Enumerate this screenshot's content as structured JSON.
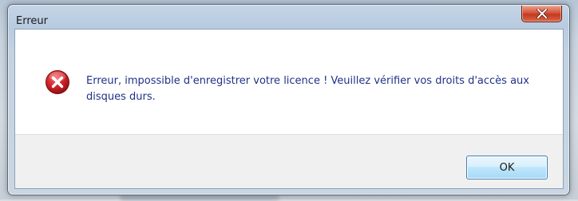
{
  "dialog": {
    "title": "Erreur",
    "message": "Erreur, impossible d'enregistrer votre licence ! Veuillez vérifier vos droits d'accès aux disques durs.",
    "icon": "error-icon",
    "ok_label": "OK",
    "close_icon": "close-icon"
  },
  "colors": {
    "message_text": "#1e3287",
    "close_button": "#c23a20",
    "error_icon": "#c1272d",
    "ok_border": "#3c7fb1"
  }
}
